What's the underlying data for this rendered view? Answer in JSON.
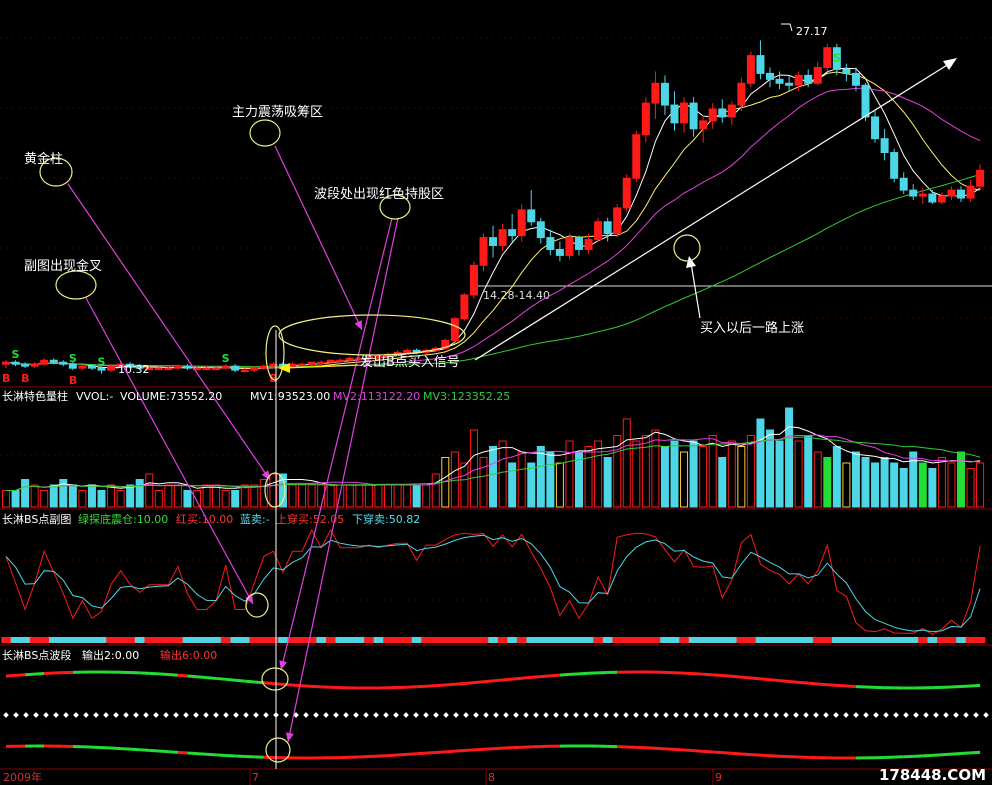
{
  "colors": {
    "up": "#ff1a1a",
    "down": "#4dd6e6",
    "vol_gold": "#ffcc33",
    "vol_green": "#22dd33",
    "ma5": "#ffffff",
    "ma10": "#ffee66",
    "ma20": "#e040e0",
    "ma60": "#33cc33",
    "arrow": "#e040e0",
    "grid": "#8b0000",
    "text_white": "#ffffff",
    "text_cyan": "#55ddee",
    "text_red": "#ff3333",
    "text_green": "#33dd33"
  },
  "main": {
    "peak_label": "27.17",
    "low_label": "10.32",
    "price_range_label": "14.28-14.40",
    "s_marker": "S",
    "b_marker": "B"
  },
  "annotations": {
    "golden_column": "黄金柱",
    "sub_cross": "副图出现金叉",
    "absorb_zone": "主力震荡吸筹区",
    "hold_zone": "波段处出现红色持股区",
    "buy_signal": "发出B点买入信号",
    "rise_after_buy": "买入以后一路上涨"
  },
  "vol_panel": {
    "name": "长淋特色量柱",
    "vvol": "VVOL:-",
    "volume": "VOLUME:73552.20",
    "mv1": "MV1:93523.00",
    "mv2": "MV2:113122.20",
    "mv3": "MV3:123352.25"
  },
  "bs_panel": {
    "name": "长淋BS点副图",
    "green_probe": "绿探底震仓:10.00",
    "red_buy": "红买:10.00",
    "blue_sell": "蓝卖:-",
    "up_cross_buy": "上穿买:52.05",
    "down_cross_sell": "下穿卖:50.82"
  },
  "wave_panel": {
    "name": "长淋BS点波段",
    "out2": "输出2:0.00",
    "out6": "输出6:0.00"
  },
  "x_axis": {
    "year": "2009年",
    "ticks": [
      "7",
      "8",
      "9"
    ]
  },
  "watermark": "178448.COM",
  "chart_data": {
    "type": "candlestick",
    "title": "",
    "xlabel": "",
    "ylabel": "",
    "x_ticks": [
      "2009年",
      "7",
      "8",
      "9"
    ],
    "series": [
      {
        "name": "K",
        "values": [
          [
            10.8,
            11.0,
            10.6,
            10.9
          ],
          [
            10.9,
            11.0,
            10.7,
            10.8
          ],
          [
            10.8,
            10.9,
            10.6,
            10.7
          ],
          [
            10.7,
            10.9,
            10.6,
            10.8
          ],
          [
            10.8,
            11.1,
            10.7,
            11.0
          ],
          [
            11.0,
            11.1,
            10.8,
            10.9
          ],
          [
            10.9,
            11.0,
            10.7,
            10.8
          ],
          [
            10.8,
            10.9,
            10.5,
            10.6
          ],
          [
            10.6,
            10.8,
            10.5,
            10.7
          ],
          [
            10.7,
            10.8,
            10.5,
            10.6
          ],
          [
            10.6,
            10.7,
            10.32,
            10.5
          ],
          [
            10.5,
            10.8,
            10.4,
            10.7
          ],
          [
            10.7,
            10.9,
            10.6,
            10.8
          ],
          [
            10.8,
            10.9,
            10.6,
            10.7
          ],
          [
            10.7,
            10.8,
            10.5,
            10.6
          ],
          [
            10.6,
            10.7,
            10.5,
            10.6
          ],
          [
            10.6,
            10.7,
            10.5,
            10.6
          ],
          [
            10.6,
            10.7,
            10.5,
            10.6
          ],
          [
            10.6,
            10.8,
            10.5,
            10.7
          ],
          [
            10.7,
            10.8,
            10.5,
            10.6
          ],
          [
            10.6,
            10.7,
            10.5,
            10.6
          ],
          [
            10.6,
            10.7,
            10.5,
            10.6
          ],
          [
            10.6,
            10.7,
            10.5,
            10.6
          ],
          [
            10.6,
            10.8,
            10.5,
            10.7
          ],
          [
            10.7,
            10.8,
            10.4,
            10.5
          ],
          [
            10.5,
            10.6,
            10.4,
            10.5
          ],
          [
            10.5,
            10.7,
            10.4,
            10.6
          ],
          [
            10.6,
            10.8,
            10.5,
            10.7
          ],
          [
            10.7,
            10.9,
            10.6,
            10.8
          ],
          [
            10.8,
            10.9,
            10.6,
            10.7
          ],
          [
            10.7,
            10.9,
            10.6,
            10.8
          ],
          [
            10.8,
            10.9,
            10.7,
            10.8
          ],
          [
            10.8,
            10.9,
            10.7,
            10.9
          ],
          [
            10.9,
            11.0,
            10.7,
            10.9
          ],
          [
            10.9,
            11.0,
            10.8,
            11.0
          ],
          [
            11.0,
            11.1,
            10.9,
            11.0
          ],
          [
            11.0,
            11.2,
            10.9,
            11.1
          ],
          [
            11.1,
            11.2,
            11.0,
            11.1
          ],
          [
            11.1,
            11.3,
            11.0,
            11.2
          ],
          [
            11.2,
            11.3,
            11.0,
            11.2
          ],
          [
            11.2,
            11.4,
            11.1,
            11.3
          ],
          [
            11.3,
            11.5,
            11.2,
            11.4
          ],
          [
            11.4,
            11.6,
            11.3,
            11.5
          ],
          [
            11.5,
            11.6,
            11.3,
            11.4
          ],
          [
            11.4,
            11.6,
            11.3,
            11.5
          ],
          [
            11.5,
            11.7,
            11.4,
            11.6
          ],
          [
            11.6,
            12.1,
            11.5,
            12.0
          ],
          [
            12.0,
            13.2,
            11.9,
            13.1
          ],
          [
            13.1,
            14.4,
            13.0,
            14.3
          ],
          [
            14.3,
            16.0,
            14.1,
            15.8
          ],
          [
            15.8,
            17.4,
            15.5,
            17.2
          ],
          [
            17.2,
            17.8,
            16.2,
            16.8
          ],
          [
            16.8,
            17.9,
            16.5,
            17.6
          ],
          [
            17.6,
            18.4,
            17.0,
            17.3
          ],
          [
            17.3,
            18.9,
            17.0,
            18.6
          ],
          [
            18.6,
            19.6,
            17.8,
            18.0
          ],
          [
            18.0,
            18.2,
            16.9,
            17.2
          ],
          [
            17.2,
            17.6,
            16.3,
            16.6
          ],
          [
            16.6,
            17.0,
            16.0,
            16.3
          ],
          [
            16.3,
            17.4,
            16.1,
            17.2
          ],
          [
            17.2,
            17.3,
            16.3,
            16.6
          ],
          [
            16.6,
            17.4,
            16.4,
            17.1
          ],
          [
            17.1,
            18.2,
            17.0,
            18.0
          ],
          [
            18.0,
            18.2,
            17.0,
            17.4
          ],
          [
            17.4,
            18.9,
            17.2,
            18.7
          ],
          [
            18.7,
            20.4,
            18.5,
            20.2
          ],
          [
            20.2,
            22.6,
            20.0,
            22.4
          ],
          [
            22.4,
            24.3,
            22.0,
            24.0
          ],
          [
            24.0,
            25.6,
            23.2,
            25.0
          ],
          [
            25.0,
            25.4,
            23.4,
            23.9
          ],
          [
            23.9,
            24.6,
            22.6,
            23.0
          ],
          [
            23.0,
            24.3,
            22.5,
            24.0
          ],
          [
            24.0,
            24.3,
            22.3,
            22.7
          ],
          [
            22.7,
            23.4,
            22.0,
            23.1
          ],
          [
            23.1,
            24.0,
            22.7,
            23.7
          ],
          [
            23.7,
            24.2,
            23.0,
            23.3
          ],
          [
            23.3,
            24.1,
            22.9,
            23.9
          ],
          [
            23.9,
            25.3,
            23.6,
            25.0
          ],
          [
            25.0,
            26.6,
            24.8,
            26.4
          ],
          [
            26.4,
            27.17,
            25.2,
            25.5
          ],
          [
            25.5,
            25.8,
            24.8,
            25.2
          ],
          [
            25.2,
            25.6,
            24.7,
            25.0
          ],
          [
            25.0,
            25.4,
            24.6,
            24.9
          ],
          [
            24.9,
            25.6,
            24.6,
            25.4
          ],
          [
            25.4,
            25.7,
            24.8,
            25.0
          ],
          [
            25.0,
            26.1,
            24.9,
            25.8
          ],
          [
            25.8,
            27.0,
            25.6,
            26.8
          ],
          [
            26.8,
            27.0,
            25.4,
            25.7
          ],
          [
            25.7,
            26.0,
            25.1,
            25.5
          ],
          [
            25.5,
            25.8,
            24.6,
            24.9
          ],
          [
            24.9,
            25.0,
            23.1,
            23.3
          ],
          [
            23.3,
            23.6,
            22.0,
            22.2
          ],
          [
            22.2,
            22.7,
            21.1,
            21.5
          ],
          [
            21.5,
            21.7,
            20.0,
            20.2
          ],
          [
            20.2,
            20.5,
            19.4,
            19.6
          ],
          [
            19.6,
            19.9,
            19.1,
            19.3
          ],
          [
            19.3,
            19.7,
            18.9,
            19.4
          ],
          [
            19.4,
            19.6,
            18.9,
            19.0
          ],
          [
            19.0,
            19.5,
            18.9,
            19.3
          ],
          [
            19.3,
            19.8,
            19.1,
            19.6
          ],
          [
            19.6,
            19.8,
            19.0,
            19.2
          ],
          [
            19.2,
            20.1,
            19.0,
            19.8
          ],
          [
            19.8,
            20.9,
            19.6,
            20.6
          ]
        ]
      }
    ],
    "volume": {
      "values": [
        3,
        3,
        5,
        4,
        3,
        4,
        5,
        4,
        3,
        4,
        3,
        4,
        3,
        4,
        5,
        6,
        3,
        4,
        4,
        3,
        3,
        4,
        4,
        3,
        3,
        4,
        4,
        5,
        6,
        6,
        4,
        4,
        4,
        4,
        4,
        4,
        4,
        4,
        4,
        4,
        4,
        4,
        4,
        4,
        4,
        6,
        9,
        10,
        8,
        14,
        9,
        11,
        12,
        8,
        10,
        8,
        11,
        10,
        8,
        12,
        10,
        11,
        12,
        9,
        13,
        16,
        12,
        13,
        14,
        11,
        12,
        10,
        12,
        11,
        13,
        9,
        12,
        11,
        13,
        16,
        14,
        12,
        18,
        12,
        13,
        10,
        9,
        11,
        8,
        10,
        9,
        8,
        9,
        8,
        7,
        10,
        8,
        7,
        9,
        8,
        10,
        7,
        8
      ]
    },
    "oscillator": {
      "up_cross_buy": 52.05,
      "down_cross_sell": 50.82
    }
  }
}
